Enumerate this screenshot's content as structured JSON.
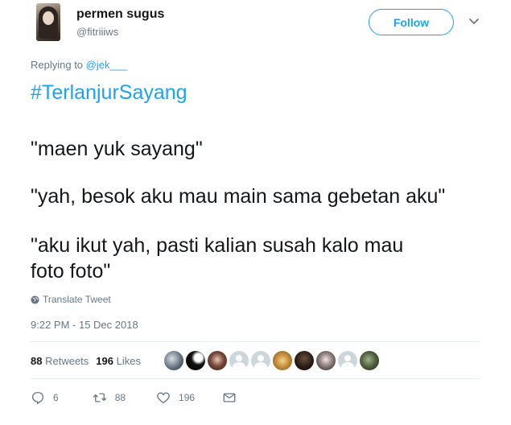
{
  "user": {
    "display_name": "permen sugus",
    "handle": "@fitriiiws",
    "follow_label": "Follow"
  },
  "reply": {
    "prefix": "Replying to ",
    "mention": "@jek___"
  },
  "tweet": {
    "hashtag": "#TerlanjurSayang",
    "lines": [
      "\"maen yuk sayang\"",
      "\"yah, besok aku mau main sama gebetan aku\"",
      "\"aku ikut yah, pasti kalian susah kalo mau",
      "foto foto\""
    ]
  },
  "translate_label": "Translate Tweet",
  "timestamp": "9:22 PM - 15 Dec 2018",
  "stats": {
    "retweets_count": "88",
    "retweets_label": "Retweets",
    "likes_count": "196",
    "likes_label": "Likes"
  },
  "actions": {
    "replies": "6",
    "retweets": "88",
    "likes": "196"
  },
  "colors": {
    "accent": "#1da1f2",
    "secondary_text": "#657786",
    "primary_text": "#14171a",
    "divider": "#e6ecf0"
  }
}
